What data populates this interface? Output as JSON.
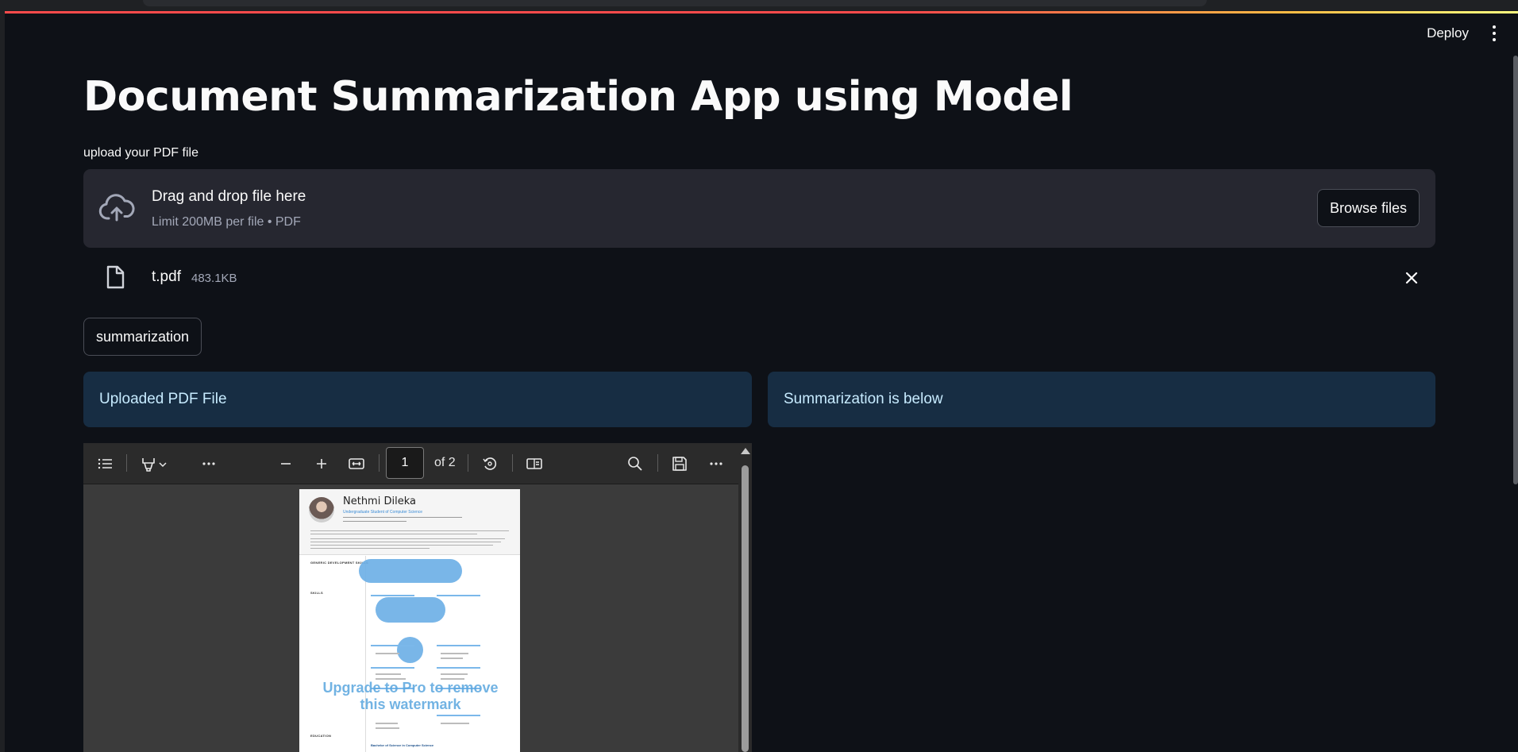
{
  "header": {
    "deploy_label": "Deploy"
  },
  "page": {
    "title": "Document Summarization App using Model"
  },
  "uploader": {
    "label": "upload your PDF file",
    "drop_title": "Drag and drop file here",
    "drop_limit": "Limit 200MB per file • PDF",
    "browse_label": "Browse files"
  },
  "file": {
    "name": "t.pdf",
    "size": "483.1KB"
  },
  "actions": {
    "summarize_label": "summarization"
  },
  "panels": {
    "left_info": "Uploaded PDF File",
    "right_info": "Summarization is below"
  },
  "pdf_viewer": {
    "current_page": "1",
    "page_count_label": "of 2",
    "document": {
      "name": "Nethmi Dileka",
      "subtitle": "Undergraduate Student of Computer Science",
      "watermark": "Upgrade to Pro to remove this watermark",
      "sections": [
        "GENERIC DEVELOPMENT SKILLS",
        "SKILLS",
        "EDUCATION"
      ],
      "education_entry": "Bachelor of Science in Computer Science"
    }
  },
  "colors": {
    "background": "#0e1117",
    "info_box": "#172d43",
    "info_text": "#c7ebff",
    "dropzone": "#262730",
    "accent_bar": "#ff4b4b"
  }
}
